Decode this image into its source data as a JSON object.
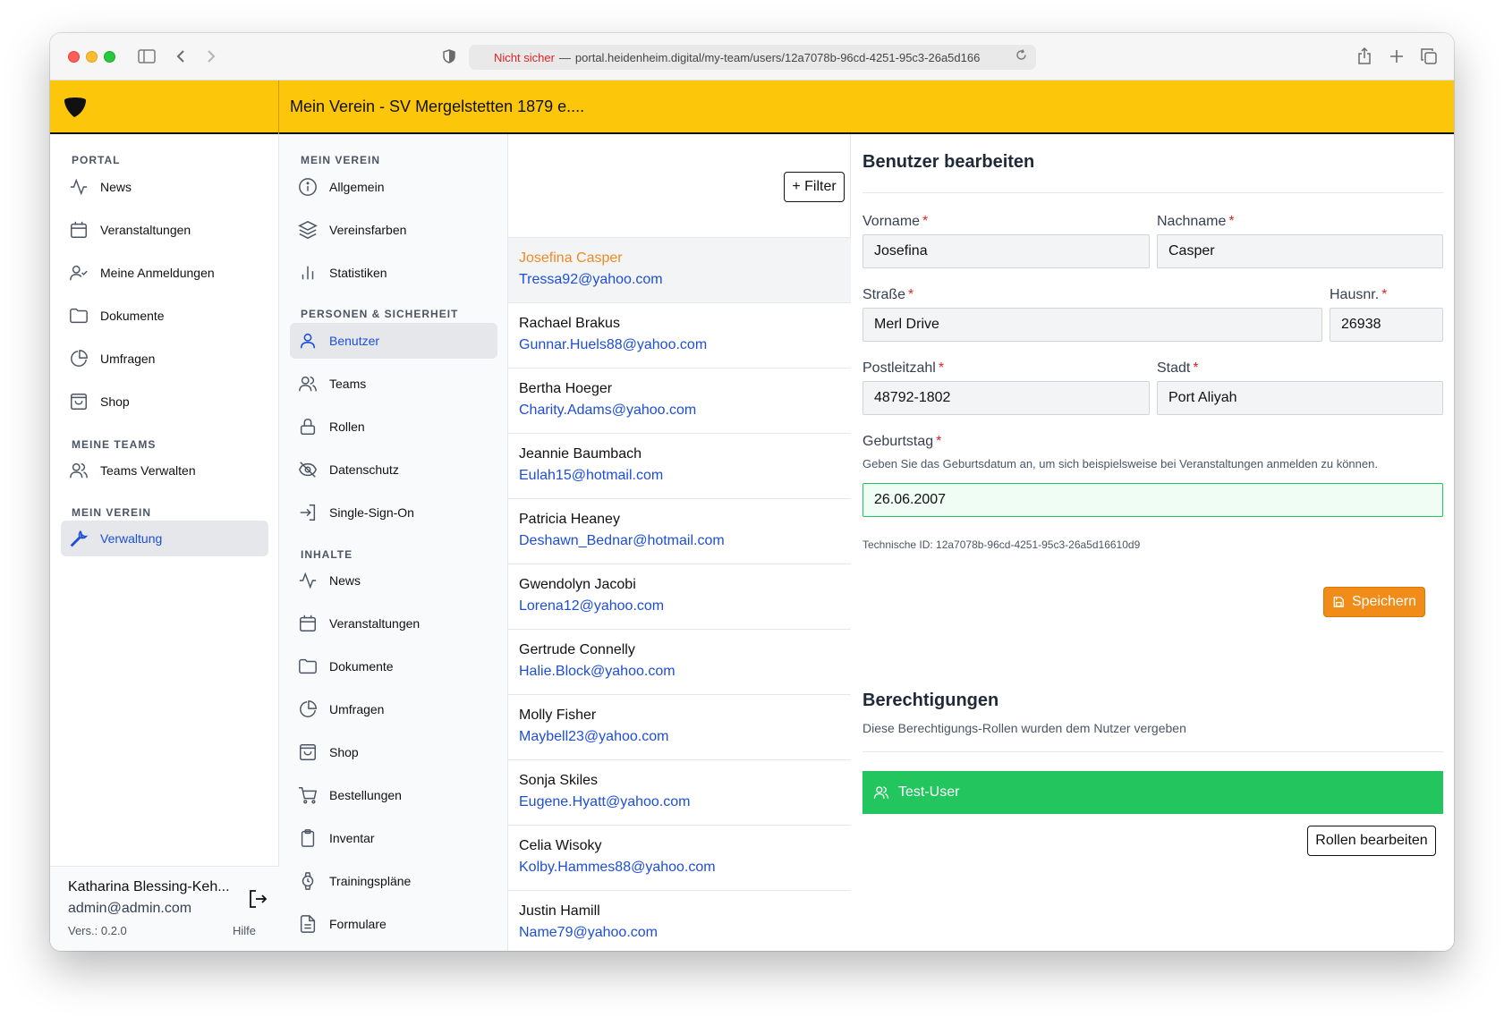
{
  "browser": {
    "url_warning": "Nicht sicher",
    "url_separator": "—",
    "url": "portal.heidenheim.digital/my-team/users/12a7078b-96cd-4251-95c3-26a5d166"
  },
  "topbar": {
    "title": "Mein Verein - SV Mergelstetten 1879 e...."
  },
  "sidebar": {
    "sections": {
      "portal": "PORTAL",
      "teams": "MEINE TEAMS",
      "verein": "MEIN VEREIN"
    },
    "items": [
      {
        "label": "News",
        "icon": "activity-icon"
      },
      {
        "label": "Veranstaltungen",
        "icon": "calendar-icon"
      },
      {
        "label": "Meine Anmeldungen",
        "icon": "user-check-icon"
      },
      {
        "label": "Dokumente",
        "icon": "folder-icon"
      },
      {
        "label": "Umfragen",
        "icon": "pie-chart-icon"
      },
      {
        "label": "Shop",
        "icon": "shopping-bag-icon"
      },
      {
        "label": "Teams Verwalten",
        "icon": "users-icon"
      },
      {
        "label": "Verwaltung",
        "icon": "wrench-icon",
        "active": true
      }
    ],
    "user": {
      "name": "Katharina Blessing-Keh...",
      "email": "admin@admin.com",
      "version": "Vers.: 0.2.0",
      "help": "Hilfe"
    }
  },
  "subnav": {
    "sections": {
      "verein": "MEIN VEREIN",
      "personen": "PERSONEN & SICHERHEIT",
      "inhalte": "INHALTE"
    },
    "items": [
      {
        "label": "Allgemein",
        "icon": "info-icon"
      },
      {
        "label": "Vereinsfarben",
        "icon": "layers-icon"
      },
      {
        "label": "Statistiken",
        "icon": "bar-chart-icon"
      },
      {
        "label": "Benutzer",
        "icon": "user-icon",
        "active": true
      },
      {
        "label": "Teams",
        "icon": "users-icon"
      },
      {
        "label": "Rollen",
        "icon": "lock-icon"
      },
      {
        "label": "Datenschutz",
        "icon": "eye-off-icon"
      },
      {
        "label": "Single-Sign-On",
        "icon": "log-in-icon"
      },
      {
        "label": "News",
        "icon": "activity-icon"
      },
      {
        "label": "Veranstaltungen",
        "icon": "calendar-icon"
      },
      {
        "label": "Dokumente",
        "icon": "folder-icon"
      },
      {
        "label": "Umfragen",
        "icon": "pie-chart-icon"
      },
      {
        "label": "Shop",
        "icon": "shopping-bag-icon"
      },
      {
        "label": "Bestellungen",
        "icon": "shopping-cart-icon"
      },
      {
        "label": "Inventar",
        "icon": "clipboard-icon"
      },
      {
        "label": "Trainingspläne",
        "icon": "watch-icon"
      },
      {
        "label": "Formulare",
        "icon": "file-text-icon"
      }
    ]
  },
  "userlist": {
    "filter_label": "+ Filter",
    "users": [
      {
        "name": "Josefina Casper",
        "email": "Tressa92@yahoo.com",
        "selected": true
      },
      {
        "name": "Rachael Brakus",
        "email": "Gunnar.Huels88@yahoo.com"
      },
      {
        "name": "Bertha Hoeger",
        "email": "Charity.Adams@yahoo.com"
      },
      {
        "name": "Jeannie Baumbach",
        "email": "Eulah15@hotmail.com"
      },
      {
        "name": "Patricia Heaney",
        "email": "Deshawn_Bednar@hotmail.com"
      },
      {
        "name": "Gwendolyn Jacobi",
        "email": "Lorena12@yahoo.com"
      },
      {
        "name": "Gertrude Connelly",
        "email": "Halie.Block@yahoo.com"
      },
      {
        "name": "Molly Fisher",
        "email": "Maybell23@yahoo.com"
      },
      {
        "name": "Sonja Skiles",
        "email": "Eugene.Hyatt@yahoo.com"
      },
      {
        "name": "Celia Wisoky",
        "email": "Kolby.Hammes88@yahoo.com"
      },
      {
        "name": "Justin Hamill",
        "email": "Name79@yahoo.com"
      }
    ]
  },
  "edit": {
    "title": "Benutzer bearbeiten",
    "fields": {
      "vorname": {
        "label": "Vorname",
        "value": "Josefina"
      },
      "nachname": {
        "label": "Nachname",
        "value": "Casper"
      },
      "strasse": {
        "label": "Straße",
        "value": "Merl Drive"
      },
      "hausnr": {
        "label": "Hausnr.",
        "value": "26938"
      },
      "plz": {
        "label": "Postleitzahl",
        "value": "48792-1802"
      },
      "stadt": {
        "label": "Stadt",
        "value": "Port Aliyah"
      },
      "geburtstag": {
        "label": "Geburtstag",
        "value": "26.06.2007",
        "help": "Geben Sie das Geburtsdatum an, um sich beispielsweise bei Veranstaltungen anmelden zu können."
      }
    },
    "required_mark": "*",
    "technical_id": "Technische ID: 12a7078b-96cd-4251-95c3-26a5d16610d9",
    "save_label": "Speichern"
  },
  "permissions": {
    "title": "Berechtigungen",
    "description": "Diese Berechtigungs-Rollen wurden dem Nutzer vergeben",
    "roles": [
      {
        "label": "Test-User"
      }
    ],
    "edit_roles_label": "Rollen bearbeiten"
  },
  "colors": {
    "brand_yellow": "#fcc70a",
    "link_blue": "#1d4ed8",
    "accent_orange": "#f28c18",
    "role_green": "#22c55e"
  }
}
